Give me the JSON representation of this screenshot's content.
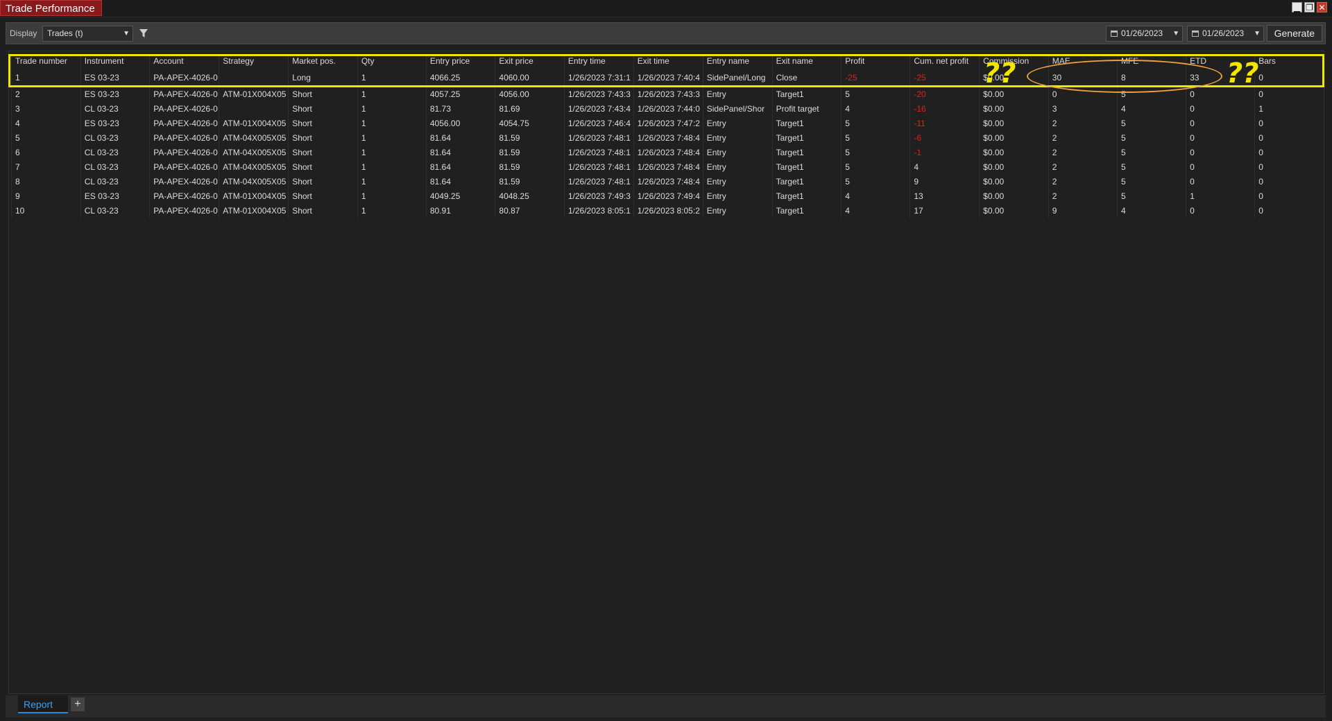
{
  "window": {
    "title": "Trade Performance"
  },
  "toolbar": {
    "display_label": "Display",
    "display_value": "Trades (t)",
    "date_from": "01/26/2023",
    "date_to": "01/26/2023",
    "generate_label": "Generate"
  },
  "columns": [
    "Trade number",
    "Instrument",
    "Account",
    "Strategy",
    "Market pos.",
    "Qty",
    "Entry price",
    "Exit price",
    "Entry time",
    "Exit time",
    "Entry name",
    "Exit name",
    "Profit",
    "Cum. net profit",
    "Commission",
    "MAE",
    "MFE",
    "ETD",
    "Bars"
  ],
  "rows": [
    [
      "1",
      "ES 03-23",
      "PA-APEX-4026-0",
      "",
      "Long",
      "1",
      "4066.25",
      "4060.00",
      "1/26/2023 7:31:1",
      "1/26/2023 7:40:4",
      "SidePanel/Long",
      "Close",
      "-25",
      "-25",
      "$0.00",
      "30",
      "8",
      "33",
      "0"
    ],
    [
      "2",
      "ES 03-23",
      "PA-APEX-4026-0",
      "ATM-01X004X05",
      "Short",
      "1",
      "4057.25",
      "4056.00",
      "1/26/2023 7:43:3",
      "1/26/2023 7:43:3",
      "Entry",
      "Target1",
      "5",
      "-20",
      "$0.00",
      "0",
      "5",
      "0",
      "0"
    ],
    [
      "3",
      "CL 03-23",
      "PA-APEX-4026-0",
      "",
      "Short",
      "1",
      "81.73",
      "81.69",
      "1/26/2023 7:43:4",
      "1/26/2023 7:44:0",
      "SidePanel/Shor",
      "Profit target",
      "4",
      "-16",
      "$0.00",
      "3",
      "4",
      "0",
      "1"
    ],
    [
      "4",
      "ES 03-23",
      "PA-APEX-4026-0",
      "ATM-01X004X05",
      "Short",
      "1",
      "4056.00",
      "4054.75",
      "1/26/2023 7:46:4",
      "1/26/2023 7:47:2",
      "Entry",
      "Target1",
      "5",
      "-11",
      "$0.00",
      "2",
      "5",
      "0",
      "0"
    ],
    [
      "5",
      "CL 03-23",
      "PA-APEX-4026-0",
      "ATM-04X005X05",
      "Short",
      "1",
      "81.64",
      "81.59",
      "1/26/2023 7:48:1",
      "1/26/2023 7:48:4",
      "Entry",
      "Target1",
      "5",
      "-6",
      "$0.00",
      "2",
      "5",
      "0",
      "0"
    ],
    [
      "6",
      "CL 03-23",
      "PA-APEX-4026-0",
      "ATM-04X005X05",
      "Short",
      "1",
      "81.64",
      "81.59",
      "1/26/2023 7:48:1",
      "1/26/2023 7:48:4",
      "Entry",
      "Target1",
      "5",
      "-1",
      "$0.00",
      "2",
      "5",
      "0",
      "0"
    ],
    [
      "7",
      "CL 03-23",
      "PA-APEX-4026-0",
      "ATM-04X005X05",
      "Short",
      "1",
      "81.64",
      "81.59",
      "1/26/2023 7:48:1",
      "1/26/2023 7:48:4",
      "Entry",
      "Target1",
      "5",
      "4",
      "$0.00",
      "2",
      "5",
      "0",
      "0"
    ],
    [
      "8",
      "CL 03-23",
      "PA-APEX-4026-0",
      "ATM-04X005X05",
      "Short",
      "1",
      "81.64",
      "81.59",
      "1/26/2023 7:48:1",
      "1/26/2023 7:48:4",
      "Entry",
      "Target1",
      "5",
      "9",
      "$0.00",
      "2",
      "5",
      "0",
      "0"
    ],
    [
      "9",
      "ES 03-23",
      "PA-APEX-4026-0",
      "ATM-01X004X05",
      "Short",
      "1",
      "4049.25",
      "4048.25",
      "1/26/2023 7:49:3",
      "1/26/2023 7:49:4",
      "Entry",
      "Target1",
      "4",
      "13",
      "$0.00",
      "2",
      "5",
      "1",
      "0"
    ],
    [
      "10",
      "CL 03-23",
      "PA-APEX-4026-0",
      "ATM-01X004X05",
      "Short",
      "1",
      "80.91",
      "80.87",
      "1/26/2023 8:05:1",
      "1/26/2023 8:05:2",
      "Entry",
      "Target1",
      "4",
      "17",
      "$0.00",
      "9",
      "4",
      "0",
      "0"
    ]
  ],
  "annotation": {
    "mark_left": "??",
    "mark_right": "??",
    "highlight_color": "#f2e600",
    "ellipse_color": "#f0a040"
  },
  "bottom": {
    "tab_label": "Report",
    "add_label": "+"
  },
  "colors": {
    "negative": "#e02020",
    "title_bg": "#8a1a1a",
    "tab_accent": "#3da0f0"
  }
}
